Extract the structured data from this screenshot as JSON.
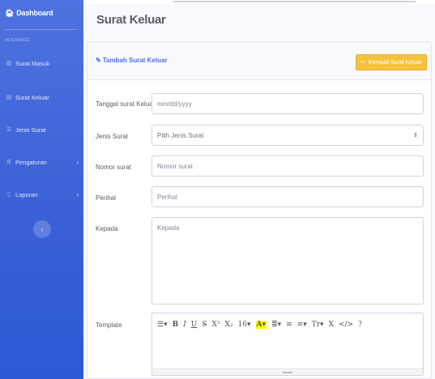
{
  "sidebar": {
    "brand": "Dashboard",
    "heading": "INTERFACE",
    "items": [
      {
        "label": "Surat Masuk"
      },
      {
        "label": "Surat Keluar"
      },
      {
        "label": "Jenis Surat"
      },
      {
        "label": "Pengaturan",
        "chevron": "›"
      },
      {
        "label": "Laporan",
        "chevron": "›"
      }
    ],
    "toggler": "‹"
  },
  "page": {
    "title": "Surat Keluar"
  },
  "card": {
    "title": "Tambah Surat Keluar",
    "back_button": "Kembali Surat Keluar"
  },
  "form": {
    "tanggal": {
      "label": "Tanggal surat Keluar",
      "placeholder": "mm/dd/yyyy"
    },
    "jenis": {
      "label": "Jenis Surat",
      "selected": "Pilih Jenis Surat"
    },
    "nomor": {
      "label": "Nomor surat",
      "placeholder": "Nomor surat"
    },
    "perihal": {
      "label": "Perihal",
      "placeholder": "Perihal"
    },
    "kepada": {
      "label": "Kepada",
      "placeholder": "Kepada"
    },
    "template": {
      "label": "Template"
    }
  },
  "editor_toolbar": [
    "☰▾",
    "B",
    "I",
    "U",
    "S̶",
    "X²",
    "X₂",
    "16▾",
    "A▾",
    "≣▾",
    "≡",
    "≡▾",
    "Tr▾",
    "X",
    "</>",
    "?"
  ],
  "colors": {
    "sidebar": "#4e73df",
    "primary": "#4e73df",
    "warning": "#f6c23e"
  }
}
